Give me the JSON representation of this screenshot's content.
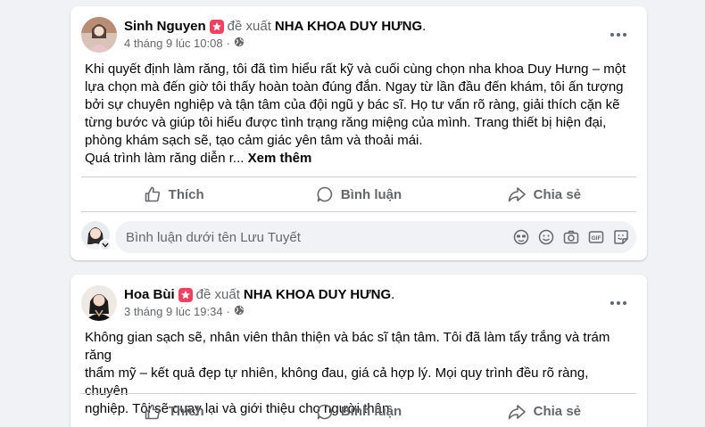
{
  "posts": [
    {
      "author": "Sinh Nguyen",
      "recommend_text": "đề xuất",
      "page": "NHA KHOA DUY HƯNG",
      "time": "4 tháng 9 lúc 10:08",
      "body_lines": [
        "Khi quyết định làm răng, tôi đã tìm hiểu rất kỹ và cuối cùng chọn nha khoa Duy Hưng – một",
        "lựa chọn mà đến giờ tôi thấy hoàn toàn đúng đắn. Ngay từ lần đầu đến khám, tôi ấn tượng",
        "bởi sự chuyên nghiệp và tận tâm của đội ngũ y bác sĩ. Họ tư vấn rõ ràng, giải thích cặn kẽ",
        "từng bước và giúp tôi hiểu được tình trạng răng miệng của mình. Trang thiết bị hiện đại,",
        "phòng khám sạch sẽ, tạo cảm giác yên tâm và thoải mái."
      ],
      "body_truncated": "Quá trình làm răng diễn r...",
      "see_more": "Xem thêm"
    },
    {
      "author": "Hoa Bùi",
      "recommend_text": "đề xuất",
      "page": "NHA KHOA DUY HƯNG",
      "time": "3 tháng 9 lúc 19:34",
      "body_lines": [
        "Không gian sạch sẽ, nhân viên thân thiện và bác sĩ tận tâm. Tôi đã làm tẩy trắng và trám răng",
        "thẩm mỹ – kết quả đẹp tự nhiên, không đau, giá cả hợp lý. Mọi quy trình đều rõ ràng, chuyên",
        "nghiệp. Tôi sẽ quay lại và giới thiệu cho người thân."
      ]
    }
  ],
  "actions": {
    "like": "Thích",
    "comment": "Bình luận",
    "share": "Chia sẻ"
  },
  "comment_box": {
    "placeholder": "Bình luận dưới tên Lưu Tuyết"
  },
  "colors": {
    "recommend": "#f3425f",
    "secondary_text": "#65676b",
    "background": "#f0f2f5"
  },
  "icons": [
    "public-globe-icon",
    "more-options-icon",
    "like-icon",
    "comment-icon",
    "share-icon",
    "avatar-sticker-icon",
    "emoji-icon",
    "camera-icon",
    "gif-icon",
    "sticker-icon"
  ]
}
